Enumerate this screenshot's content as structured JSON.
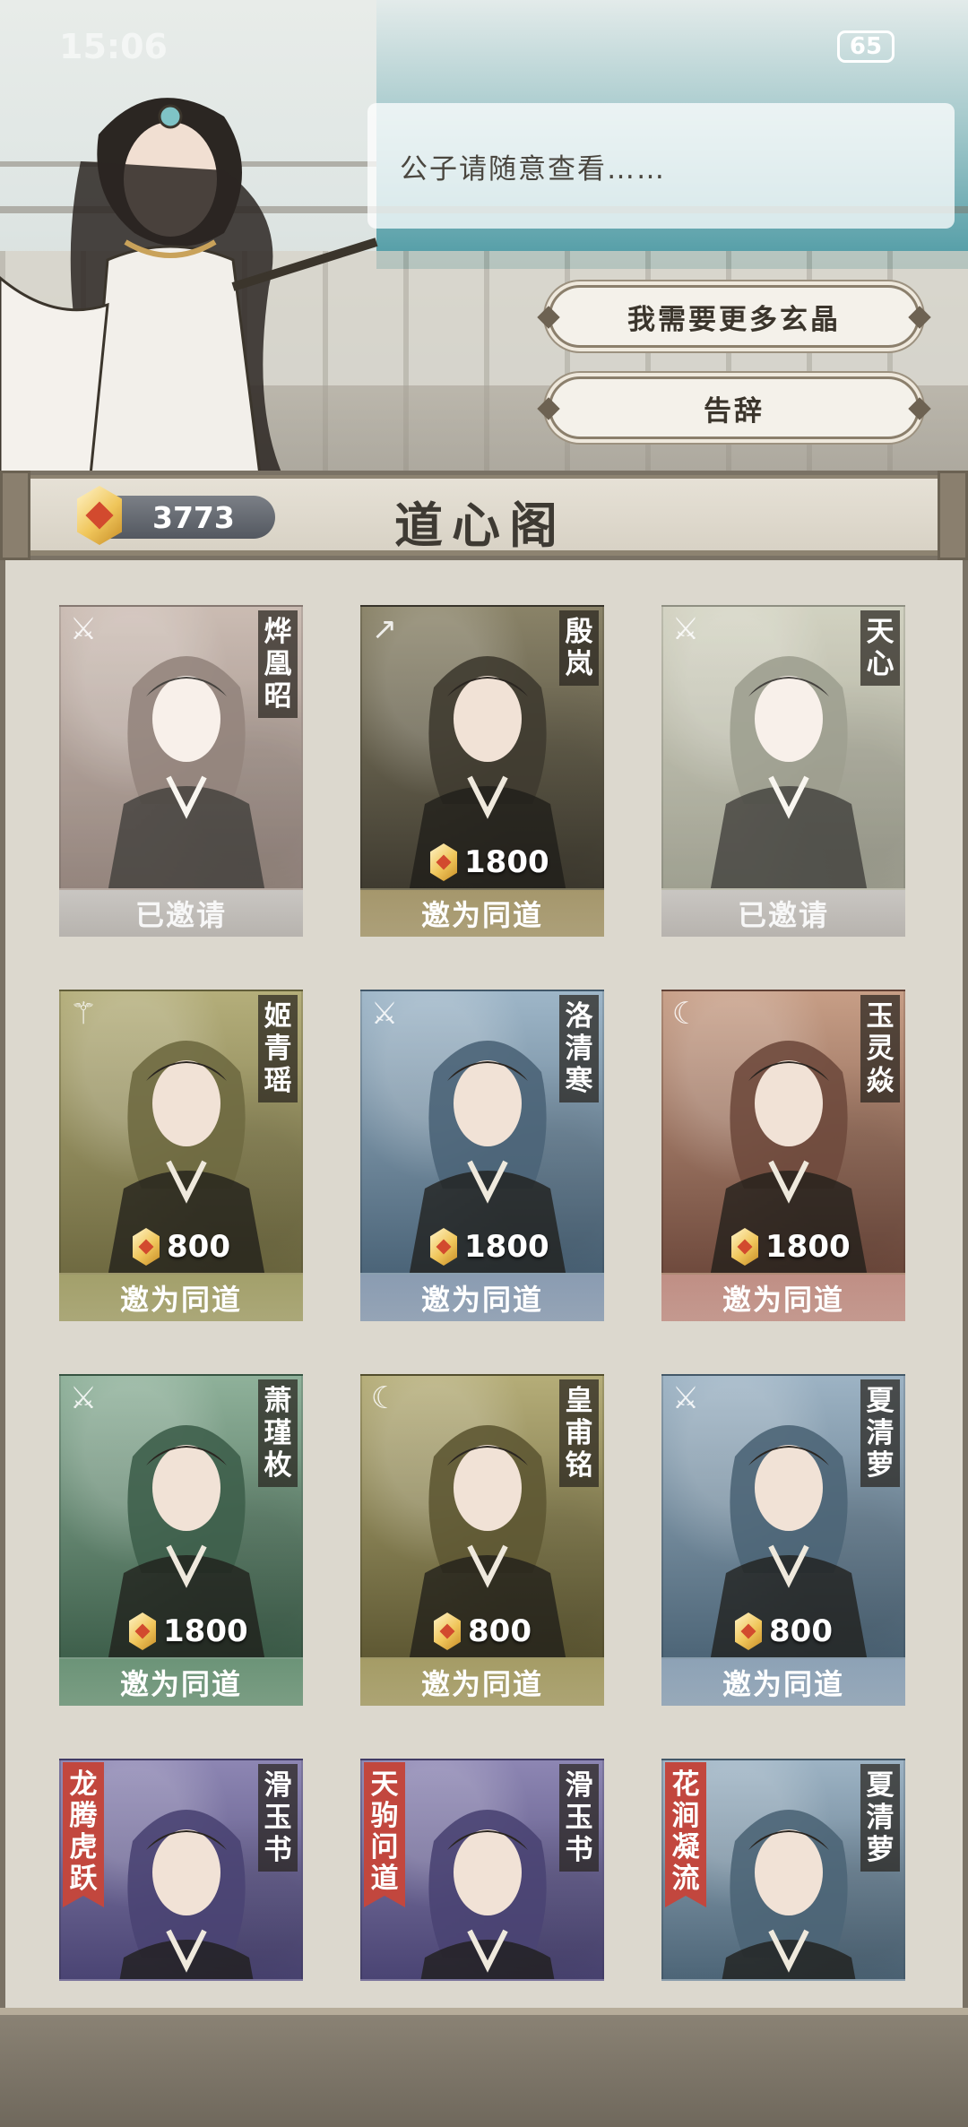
{
  "status": {
    "time": "15:06",
    "battery": "65"
  },
  "dialog": {
    "text": "公子请随意查看……",
    "options": [
      "我需要更多玄晶",
      "告辞"
    ]
  },
  "header": {
    "currency": "3773",
    "title": "道心阁"
  },
  "cards": [
    {
      "name": "烨凰昭",
      "icon": "sword-icon",
      "price": "",
      "action": "已邀请",
      "state": "invited",
      "bg": [
        "#c9a694",
        "#8e6a5c"
      ],
      "accent": "#b9b6b1"
    },
    {
      "name": "殷岚",
      "icon": "spear-icon",
      "price": "1800",
      "action": "邀为同道",
      "state": "available",
      "bg": [
        "#8a8368",
        "#3f3b30"
      ],
      "accent": "#a5976c"
    },
    {
      "name": "天心",
      "icon": "sword-icon",
      "price": "",
      "action": "已邀请",
      "state": "invited",
      "bg": [
        "#c2c39e",
        "#8a8d6c"
      ],
      "accent": "#b9b6b1"
    },
    {
      "name": "姬青瑶",
      "icon": "staff-icon",
      "price": "800",
      "action": "邀为同道",
      "state": "available",
      "bg": [
        "#b4ae7a",
        "#6f6a41"
      ],
      "accent": "#a3a06b"
    },
    {
      "name": "洛清寒",
      "icon": "sword-icon",
      "price": "1800",
      "action": "邀为同道",
      "state": "available",
      "bg": [
        "#9eb6c8",
        "#4b6478"
      ],
      "accent": "#8a9cb2"
    },
    {
      "name": "玉灵焱",
      "icon": "moon-icon",
      "price": "1800",
      "action": "邀为同道",
      "state": "available",
      "bg": [
        "#c79e86",
        "#6f4a3d"
      ],
      "accent": "#c08f85"
    },
    {
      "name": "萧瑾枚",
      "icon": "sword-icon",
      "price": "1800",
      "action": "邀为同道",
      "state": "available",
      "bg": [
        "#8fb19a",
        "#3e5f4b"
      ],
      "accent": "#6c9478"
    },
    {
      "name": "皇甫铭",
      "icon": "moon-icon",
      "price": "800",
      "action": "邀为同道",
      "state": "available",
      "bg": [
        "#b5ad78",
        "#5e5833"
      ],
      "accent": "#a59c66"
    },
    {
      "name": "夏清萝",
      "icon": "sword-icon",
      "price": "800",
      "action": "邀为同道",
      "state": "available",
      "bg": [
        "#9db3c4",
        "#4d6577"
      ],
      "accent": "#8da2b6"
    },
    {
      "name": "滑玉书",
      "tag": "龙腾虎跃",
      "icon": "",
      "price": "",
      "action": "",
      "state": "skin",
      "bg": [
        "#8d86b3",
        "#4a4473"
      ],
      "accent": ""
    },
    {
      "name": "滑玉书",
      "tag": "天驹问道",
      "icon": "",
      "price": "",
      "action": "",
      "state": "skin",
      "bg": [
        "#8d86b3",
        "#4a4473"
      ],
      "accent": ""
    },
    {
      "name": "夏清萝",
      "tag": "花涧凝流",
      "icon": "",
      "price": "",
      "action": "",
      "state": "skin",
      "bg": [
        "#9db3c4",
        "#4d6577"
      ],
      "accent": ""
    }
  ]
}
